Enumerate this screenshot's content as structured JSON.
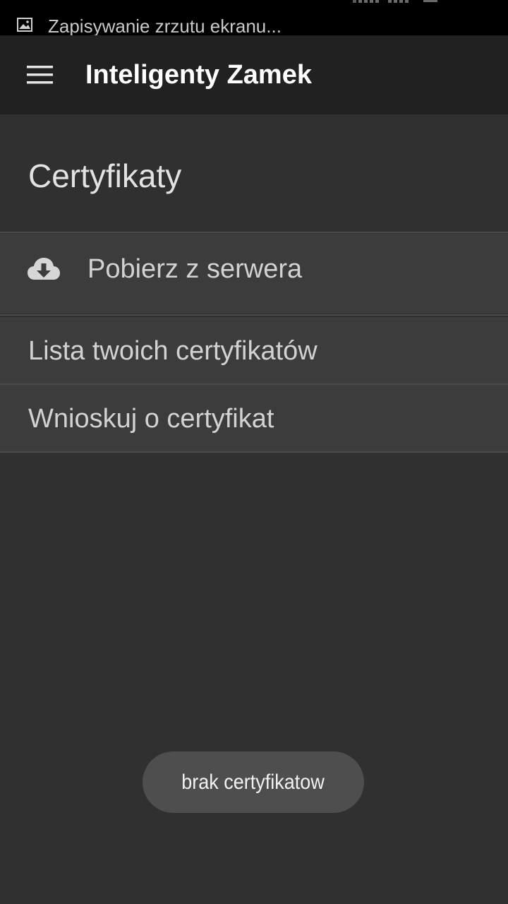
{
  "status_bar": {
    "notification_icon": "image-icon",
    "notification_text": "Zapisywanie zrzutu ekranu..."
  },
  "app_bar": {
    "menu_icon": "hamburger-menu-icon",
    "title": "Inteligenty Zamek"
  },
  "section": {
    "title": "Certyfikaty"
  },
  "menu": {
    "items": [
      {
        "icon": "cloud-download-icon",
        "label": "Pobierz z serwera"
      },
      {
        "label": "Lista twoich certyfikatów"
      },
      {
        "label": "Wnioskuj o certyfikat"
      }
    ]
  },
  "toast": {
    "text": "brak certyfikatow"
  },
  "colors": {
    "background": "#303030",
    "app_bar": "#212121",
    "row_background": "#3c3c3c",
    "toast_background": "#4e4e4e",
    "title_text": "#ffffff",
    "row_text": "#d2d2d2"
  }
}
